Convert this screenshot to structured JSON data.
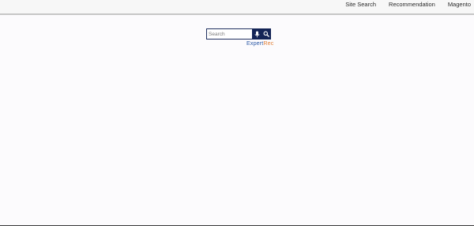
{
  "nav": {
    "items": [
      {
        "label": "Site Search"
      },
      {
        "label": "Recommendation"
      },
      {
        "label": "Magento"
      }
    ]
  },
  "search": {
    "placeholder": "Search",
    "value": ""
  },
  "icons": {
    "voice": "microphone-icon",
    "search": "search-icon"
  },
  "brand": {
    "part1": "Expert",
    "part2": "Rec",
    "color1": "#2d5aa6",
    "color2": "#e2823a"
  },
  "colors": {
    "button_bg": "#142456",
    "topbar_bg": "#f7f7f7"
  }
}
